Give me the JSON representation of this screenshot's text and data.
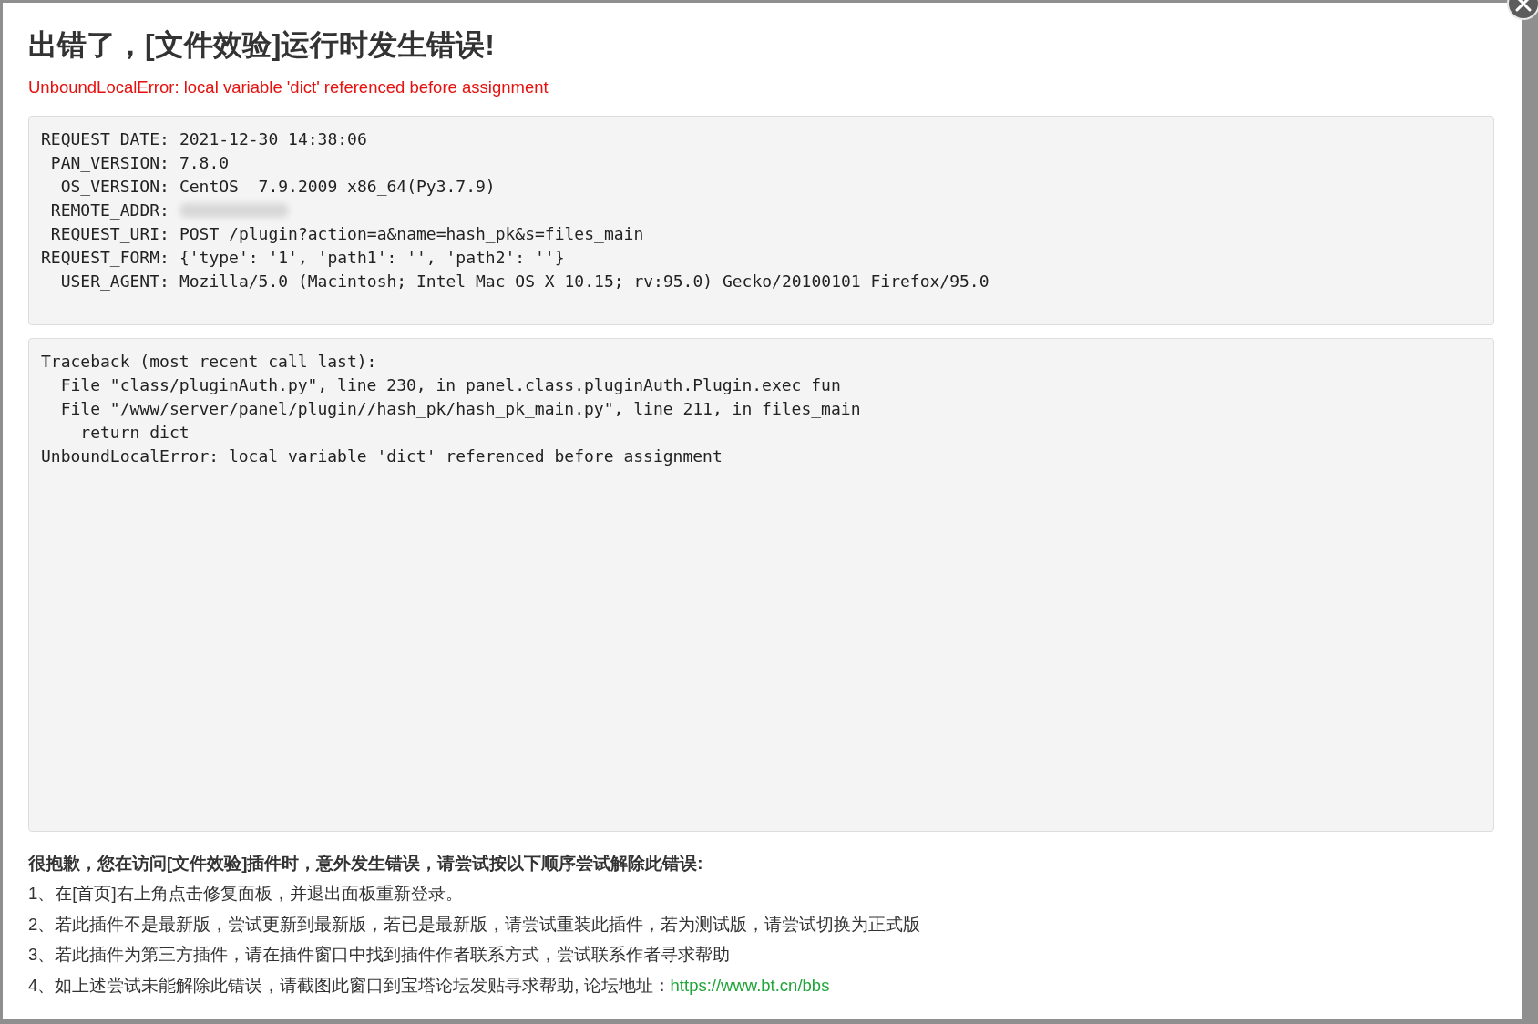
{
  "dialog": {
    "title": "出错了，[文件效验]运行时发生错误!",
    "error_message": "UnboundLocalError: local variable 'dict' referenced before assignment",
    "request_info": [
      {
        "label": "REQUEST_DATE:",
        "value": "2021-12-30 14:38:06"
      },
      {
        "label": "PAN_VERSION:",
        "value": "7.8.0"
      },
      {
        "label": "OS_VERSION:",
        "value": "CentOS  7.9.2009 x86_64(Py3.7.9)"
      },
      {
        "label": "REMOTE_ADDR:",
        "redacted": true
      },
      {
        "label": "REQUEST_URI:",
        "value": "POST /plugin?action=a&name=hash_pk&s=files_main"
      },
      {
        "label": "REQUEST_FORM:",
        "value": "{'type': '1', 'path1': '', 'path2': ''}"
      },
      {
        "label": "USER_AGENT:",
        "value": "Mozilla/5.0 (Macintosh; Intel Mac OS X 10.15; rv:95.0) Gecko/20100101 Firefox/95.0"
      }
    ],
    "traceback": [
      "Traceback (most recent call last):",
      "  File \"class/pluginAuth.py\", line 230, in panel.class.pluginAuth.Plugin.exec_fun",
      "  File \"/www/server/panel/plugin//hash_pk/hash_pk_main.py\", line 211, in files_main",
      "    return dict",
      "UnboundLocalError: local variable 'dict' referenced before assignment"
    ],
    "help_heading": "很抱歉，您在访问[文件效验]插件时，意外发生错误，请尝试按以下顺序尝试解除此错误:",
    "help_steps": [
      {
        "text": "1、在[首页]右上角点击修复面板，并退出面板重新登录。"
      },
      {
        "text": "2、若此插件不是最新版，尝试更新到最新版，若已是最新版，请尝试重装此插件，若为测试版，请尝试切换为正式版"
      },
      {
        "text": "3、若此插件为第三方插件，请在插件窗口中找到插件作者联系方式，尝试联系作者寻求帮助"
      },
      {
        "text": "4、如上述尝试未能解除此错误，请截图此窗口到宝塔论坛发贴寻求帮助, 论坛地址：",
        "link": "https://www.bt.cn/bbs"
      }
    ]
  }
}
